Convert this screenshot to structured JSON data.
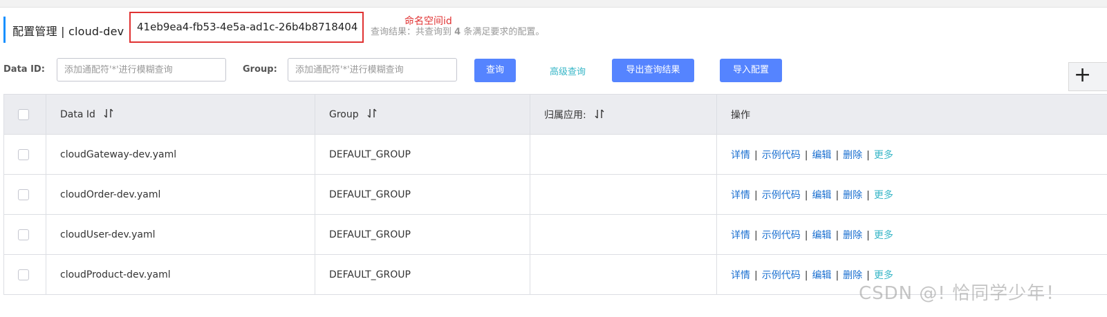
{
  "header": {
    "title_prefix": "配置管理 | cloud-dev",
    "namespace_id": "41eb9ea4-fb53-4e5a-ad1c-26b4b8718404",
    "annotation": "命名空间id",
    "query_result_prefix": "查询结果：共查询到",
    "query_result_count": "4",
    "query_result_suffix": "条满足要求的配置。"
  },
  "filters": {
    "data_id_label": "Data ID:",
    "data_id_placeholder": "添加通配符'*'进行模糊查询",
    "group_label": "Group:",
    "group_placeholder": "添加通配符'*'进行模糊查询",
    "search_button": "查询",
    "advanced_link": "高级查询",
    "export_button": "导出查询结果",
    "import_button": "导入配置",
    "corner_button": "+"
  },
  "table": {
    "columns": [
      "Data Id",
      "Group",
      "归属应用:",
      "操作"
    ],
    "rows": [
      {
        "data_id": "cloudGateway-dev.yaml",
        "group": "DEFAULT_GROUP",
        "app": ""
      },
      {
        "data_id": "cloudOrder-dev.yaml",
        "group": "DEFAULT_GROUP",
        "app": ""
      },
      {
        "data_id": "cloudUser-dev.yaml",
        "group": "DEFAULT_GROUP",
        "app": ""
      },
      {
        "data_id": "cloudProduct-dev.yaml",
        "group": "DEFAULT_GROUP",
        "app": ""
      }
    ],
    "actions": {
      "detail": "详情",
      "sample_code": "示例代码",
      "edit": "编辑",
      "delete": "删除",
      "more": "更多",
      "separator": "|"
    }
  },
  "watermark": "CSDN @! 恰同学少年！",
  "colors": {
    "primary_button": "#5584ff",
    "link": "#1a6fd0",
    "link_teal": "#37b6c7",
    "annotation_red": "#e03131",
    "table_header_bg": "#ebecf0"
  }
}
